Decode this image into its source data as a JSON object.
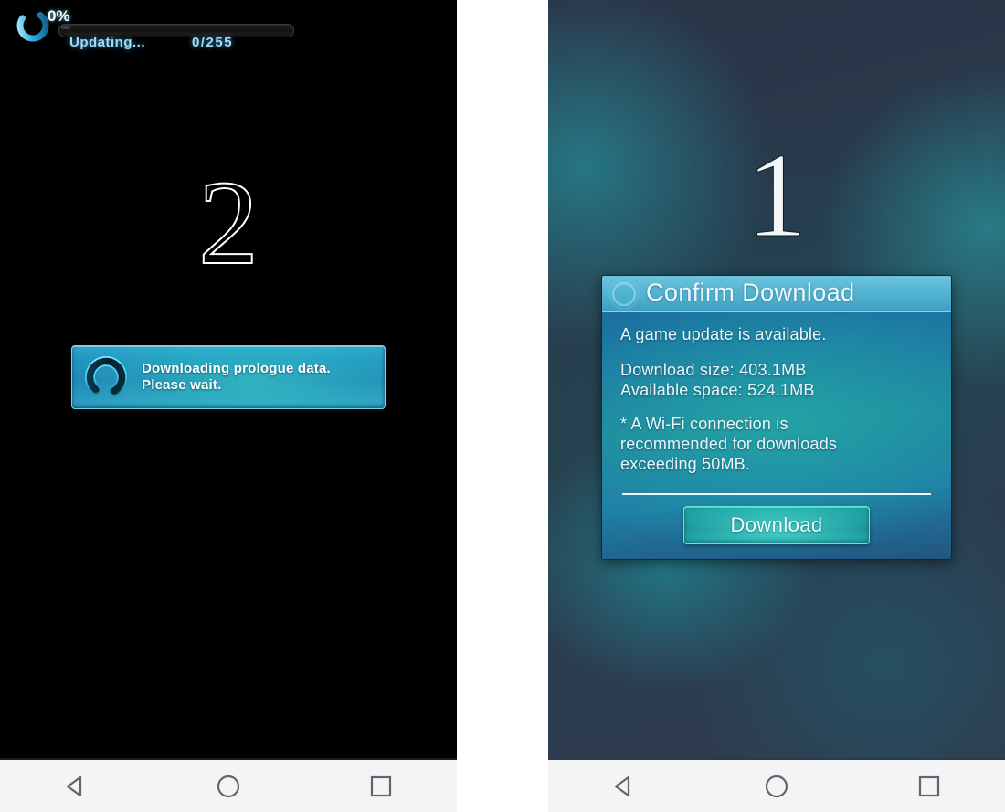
{
  "screens": [
    {
      "id": "screen-step-2",
      "step_numeral": "2",
      "hud": {
        "percent_label": "0%",
        "status_label": "Updating...",
        "count_label": "0/255",
        "progress_percent": 0,
        "spinner_icon": "loading-ring-icon"
      },
      "notice": {
        "spinner_icon": "loading-ring-icon",
        "line1": "Downloading prologue data.",
        "line2": "Please wait."
      }
    },
    {
      "id": "screen-step-1",
      "step_numeral": "1",
      "dialog": {
        "title": "Confirm Download",
        "title_ring_icon": "ring-decoration-icon",
        "intro": "A game update is available.",
        "download_size": "Download size: 403.1MB",
        "available_space": "Available space: 524.1MB",
        "note_line1": "* A Wi-Fi connection is",
        "note_line2": "recommended for downloads",
        "note_line3": "exceeding 50MB.",
        "confirm_button": "Download"
      }
    }
  ],
  "navbar": {
    "back_label": "Back",
    "home_label": "Home",
    "recents_label": "Recents",
    "back_icon": "triangle-back-icon",
    "home_icon": "circle-home-icon",
    "recents_icon": "square-recents-icon"
  },
  "colors": {
    "accent_cyan": "#6fc4dd",
    "hud_text": "#9fdcf7",
    "panel_blue": "#1f8fc0",
    "button_teal": "#128e95",
    "left_background": "#000000",
    "navbar_background": "#f4f4f4",
    "nav_icon": "#5a6673"
  }
}
